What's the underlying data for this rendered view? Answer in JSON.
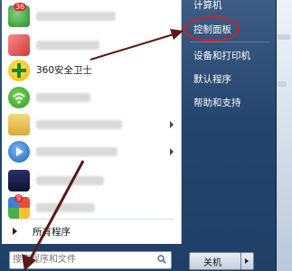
{
  "start_menu": {
    "programs": [
      {
        "label": "",
        "icon": "red-badge-app-icon",
        "badge": "36",
        "has_submenu": false
      },
      {
        "label": "",
        "icon": "red-app-icon",
        "has_submenu": false
      },
      {
        "label": "360安全卫士",
        "icon": "360-safe-icon",
        "has_submenu": false
      },
      {
        "label": "",
        "icon": "green-wifi-icon",
        "has_submenu": false
      },
      {
        "label": "",
        "icon": "folder-app-icon",
        "has_submenu": true
      },
      {
        "label": "",
        "icon": "media-player-icon",
        "has_submenu": true
      },
      {
        "label": "",
        "icon": "black-app-icon",
        "has_submenu": false
      },
      {
        "label": "",
        "icon": "colorful-badge-app-icon",
        "badge": "9",
        "has_submenu": false
      }
    ],
    "all_programs_label": "所有程序",
    "search": {
      "placeholder": "搜索程序和文件",
      "value": ""
    },
    "right_pane": {
      "computer_label": "计算机",
      "control_panel_label": "控制面板",
      "devices_printers_label": "设备和打印机",
      "default_programs_label": "默认程序",
      "help_support_label": "帮助和支持"
    },
    "shutdown_label": "关机",
    "colors": {
      "annotation_red": "#d61d22",
      "annotation_arrow": "#5b1a17"
    }
  }
}
